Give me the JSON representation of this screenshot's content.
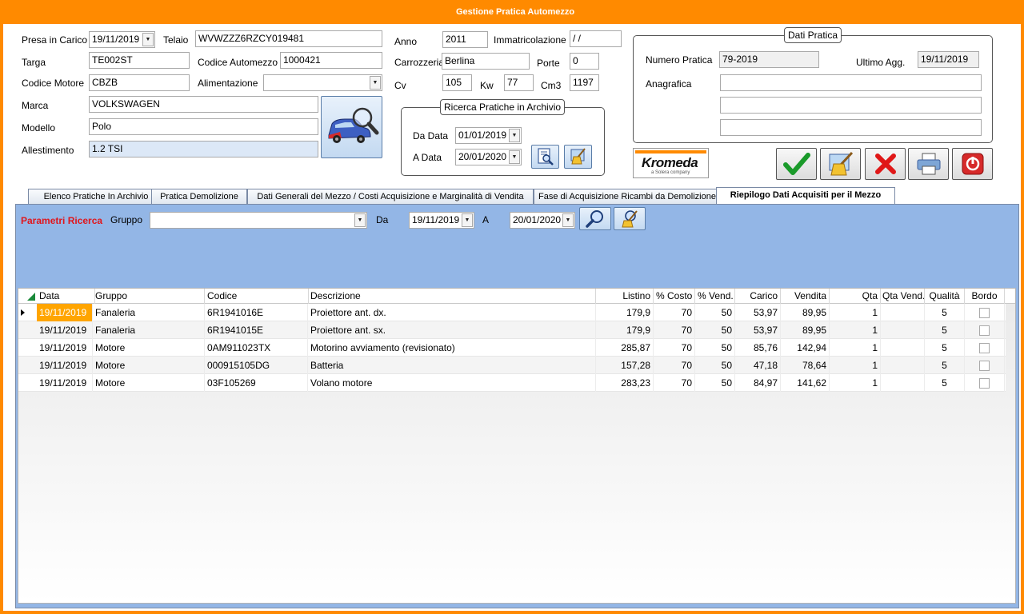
{
  "window": {
    "title": "Gestione Pratica Automezzo"
  },
  "vehicle": {
    "presa_label": "Presa in Carico",
    "presa_value": "19/11/2019",
    "telaio_label": "Telaio",
    "telaio_value": "WVWZZZ6RZCY019481",
    "targa_label": "Targa",
    "targa_value": "TE002ST",
    "codice_automezzo_label": "Codice Automezzo",
    "codice_automezzo_value": "1000421",
    "codice_motore_label": "Codice Motore",
    "codice_motore_value": "CBZB",
    "alimentazione_label": "Alimentazione",
    "alimentazione_value": "",
    "marca_label": "Marca",
    "marca_value": "VOLKSWAGEN",
    "modello_label": "Modello",
    "modello_value": "Polo",
    "allestimento_label": "Allestimento",
    "allestimento_value": "1.2 TSI",
    "anno_label": "Anno",
    "anno_value": "2011",
    "immatricolazione_label": "Immatricolazione",
    "immatricolazione_value": " / /",
    "carrozzeria_label": "Carrozzeria",
    "carrozzeria_value": "Berlina",
    "porte_label": "Porte",
    "porte_value": "0",
    "cv_label": "Cv",
    "cv_value": "105",
    "kw_label": "Kw",
    "kw_value": "77",
    "cm3_label": "Cm3",
    "cm3_value": "1197"
  },
  "ricerca": {
    "title": "Ricerca Pratiche in Archivio",
    "da_label": "Da Data",
    "da_value": "01/01/2019",
    "a_label": "A Data",
    "a_value": "20/01/2020"
  },
  "pratica": {
    "title": "Dati Pratica",
    "numero_label": "Numero Pratica",
    "numero_value": "79-2019",
    "ultimo_label": "Ultimo Agg.",
    "ultimo_value": "19/11/2019",
    "anagrafica_label": "Anagrafica",
    "anagrafica_lines": [
      "",
      "",
      ""
    ]
  },
  "logo": {
    "brand": "Kromeda",
    "tagline": "a Solera company"
  },
  "tabs": [
    {
      "label": "Elenco Pratiche In Archivio"
    },
    {
      "label": "Pratica Demolizione"
    },
    {
      "label": "Dati Generali del Mezzo / Costi Acquisizione e  Marginalità di Vendita"
    },
    {
      "label": "Fase di Acquisizione Ricambi da Demolizione"
    },
    {
      "label": "Riepilogo Dati Acquisiti per il Mezzo"
    }
  ],
  "filters": {
    "title": "Parametri Ricerca",
    "gruppo_label": "Gruppo",
    "gruppo_value": "",
    "da_label": "Da",
    "da_value": "19/11/2019",
    "a_label": "A",
    "a_value": "20/01/2020"
  },
  "grid": {
    "columns": [
      "Data",
      "Gruppo",
      "Codice",
      "Descrizione",
      "Listino",
      "% Costo",
      "% Vend.",
      "Carico",
      "Vendita",
      "Qta",
      "Qta Vend.",
      "Qualità",
      "Bordo"
    ],
    "rows": [
      [
        "19/11/2019",
        "Fanaleria",
        "6R1941016E",
        "Proiettore  ant. dx.",
        "179,9",
        "70",
        "50",
        "53,97",
        "89,95",
        "1",
        "",
        "5",
        ""
      ],
      [
        "19/11/2019",
        "Fanaleria",
        "6R1941015E",
        "Proiettore  ant. sx.",
        "179,9",
        "70",
        "50",
        "53,97",
        "89,95",
        "1",
        "",
        "5",
        ""
      ],
      [
        "19/11/2019",
        "Motore",
        "0AM911023TX",
        "Motorino avviamento (revisionato)",
        "285,87",
        "70",
        "50",
        "85,76",
        "142,94",
        "1",
        "",
        "5",
        ""
      ],
      [
        "19/11/2019",
        "Motore",
        "000915105DG",
        "Batteria",
        "157,28",
        "70",
        "50",
        "47,18",
        "78,64",
        "1",
        "",
        "5",
        ""
      ],
      [
        "19/11/2019",
        "Motore",
        "03F105269",
        "Volano motore",
        "283,23",
        "70",
        "50",
        "84,97",
        "141,62",
        "1",
        "",
        "5",
        ""
      ]
    ]
  },
  "colors": {
    "accent": "#ff8a00",
    "panel": "#93b6e6",
    "filter_title": "#e0161c",
    "selected_cell": "#ffa500"
  }
}
